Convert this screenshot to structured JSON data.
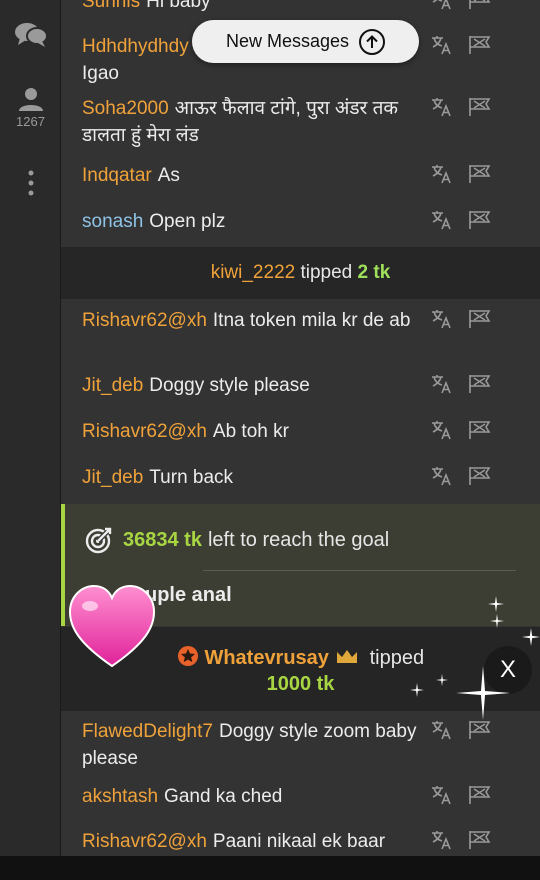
{
  "sidebar": {
    "chat_icon": "speech-bubbles-icon",
    "users_icon": "person-icon",
    "users_count": "1267",
    "more_icon": "vertical-dots-icon"
  },
  "new_messages": {
    "label": "New Messages",
    "icon": "arrow-up-circle-icon"
  },
  "messages": [
    {
      "user": "Sunnis",
      "text": "Hi baby",
      "color": "#f0a23a"
    },
    {
      "user": "Hdhdhydhdy",
      "text": "Igao",
      "color": "#f0a23a"
    },
    {
      "user": "Soha2000",
      "text": "आऊर फैलाव टांगे, पुरा अंडर तक डालता हुं मेरा लंड",
      "color": "#f0a23a"
    },
    {
      "user": "Indqatar",
      "text": "As",
      "color": "#f0a23a"
    },
    {
      "user": "sonash",
      "text": "Open plz",
      "color": "#8fc4e6"
    },
    {
      "user": "Rishavr62@xh",
      "text": "Itna token mila kr de ab",
      "color": "#f0a23a"
    },
    {
      "user": "Jit_deb",
      "text": "Doggy style please",
      "color": "#f0a23a"
    },
    {
      "user": "Rishavr62@xh",
      "text": "Ab toh kr",
      "color": "#f0a23a"
    },
    {
      "user": "Jit_deb",
      "text": "Turn back",
      "color": "#f0a23a"
    },
    {
      "user": "FlawedDelight7",
      "text": "Doggy style zoom baby please",
      "color": "#f0a23a"
    },
    {
      "user": "akshtash",
      "text": "Gand ka ched",
      "color": "#f0a23a"
    },
    {
      "user": "Rishavr62@xh",
      "text": "Paani nikaal ek baar",
      "color": "#f0a23a"
    }
  ],
  "tip_small": {
    "user": "kiwi_2222",
    "verb": "tipped",
    "amount": "2 tk"
  },
  "goal": {
    "amount": "36834 tk",
    "text": "left to reach the goal",
    "title": "uple anal",
    "icon": "target-icon"
  },
  "tip_big": {
    "user": "Whatevrusay",
    "verb": "tipped",
    "amount": "1000 tk",
    "badge_icon": "star-badge-icon",
    "crown_icon": "crown-icon"
  },
  "message_actions": {
    "translate_icon": "translate-icon",
    "report_icon": "flag-icon"
  },
  "overlay": {
    "heart_icon": "heart-icon",
    "x_logo_icon": "x-logo-icon",
    "x_logo_text": "X"
  },
  "colors": {
    "username_orange": "#f0a23a",
    "username_blue": "#8fc4e6",
    "goal_green": "#a8d642",
    "tip_green": "#9fe05a"
  }
}
